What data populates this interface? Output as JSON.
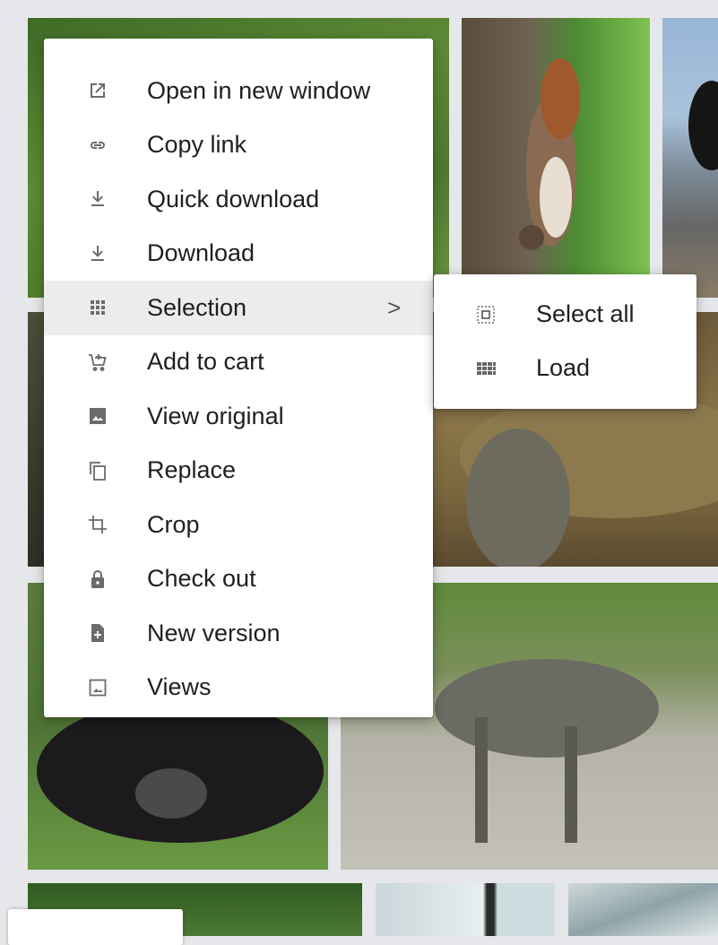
{
  "context_menu": {
    "items": [
      {
        "label": "Open in new window",
        "icon": "open-in-new-icon"
      },
      {
        "label": "Copy link",
        "icon": "link-icon"
      },
      {
        "label": "Quick download",
        "icon": "download-icon"
      },
      {
        "label": "Download",
        "icon": "download-icon"
      },
      {
        "label": "Selection",
        "icon": "grid-icon",
        "has_submenu": true,
        "chevron": ">"
      },
      {
        "label": "Add to cart",
        "icon": "add-cart-icon"
      },
      {
        "label": "View original",
        "icon": "image-icon"
      },
      {
        "label": "Replace",
        "icon": "copy-icon"
      },
      {
        "label": "Crop",
        "icon": "crop-icon"
      },
      {
        "label": "Check out",
        "icon": "lock-icon"
      },
      {
        "label": "New version",
        "icon": "new-file-icon"
      },
      {
        "label": "Views",
        "icon": "image-outline-icon"
      }
    ]
  },
  "submenu": {
    "items": [
      {
        "label": "Select all",
        "icon": "select-all-icon"
      },
      {
        "label": "Load",
        "icon": "grid-small-icon"
      }
    ]
  },
  "gallery": {
    "images": [
      {
        "name": "grass-field"
      },
      {
        "name": "squirrel-on-tree"
      },
      {
        "name": "black-cat-on-roof"
      },
      {
        "name": "tortoise"
      },
      {
        "name": "yak-lying-on-grass"
      },
      {
        "name": "tabby-cat-walking"
      },
      {
        "name": "garden-pond"
      },
      {
        "name": "bird-at-window"
      },
      {
        "name": "glass-roof"
      }
    ]
  },
  "colors": {
    "menu_bg": "#ffffff",
    "active_bg": "#ececec",
    "page_bg": "#e6e7ea"
  }
}
